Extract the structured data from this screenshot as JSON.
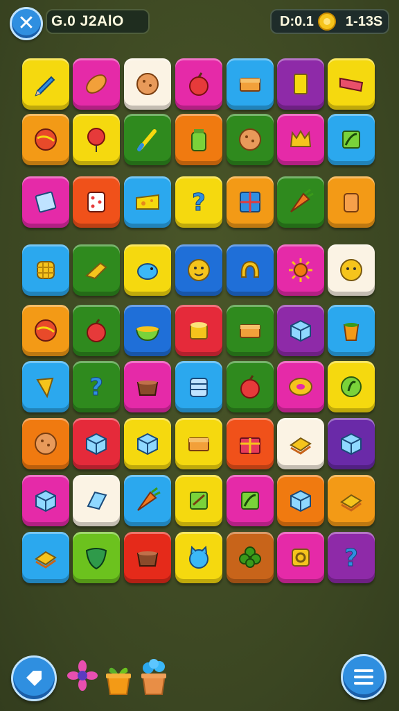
{
  "header": {
    "close_label": "✕",
    "title": "G.0 J2AlO",
    "timer": "D:0.1",
    "coins": "1-13S"
  },
  "grid": {
    "rows": 9,
    "cols": 7,
    "tiles": [
      {
        "color": "#f5d90f",
        "icon": "pencil-icon"
      },
      {
        "color": "#e52aa8",
        "icon": "bread-icon"
      },
      {
        "color": "#fbf3e4",
        "icon": "cookie-icon"
      },
      {
        "color": "#e52aa8",
        "icon": "apple-icon"
      },
      {
        "color": "#2ba8ee",
        "icon": "box-icon"
      },
      {
        "color": "#8e2aa8",
        "icon": "card-icon"
      },
      {
        "color": "#f5d90f",
        "icon": "book-icon"
      },
      {
        "color": "#f39a16",
        "icon": "ball-icon"
      },
      {
        "color": "#f5d90f",
        "icon": "balloon-icon"
      },
      {
        "color": "#2f8a1e",
        "icon": "brush-icon"
      },
      {
        "color": "#f07a10",
        "icon": "jar-icon"
      },
      {
        "color": "#2f8a1e",
        "icon": "cookie-icon"
      },
      {
        "color": "#e52aa8",
        "icon": "crown-icon"
      },
      {
        "color": "#2ba8ee",
        "icon": "leaf-card-icon"
      },
      {
        "color": "#e52aa8",
        "icon": "note-icon"
      },
      {
        "color": "#f0511a",
        "icon": "dice-icon"
      },
      {
        "color": "#2ba8ee",
        "icon": "cheese-icon"
      },
      {
        "color": "#f5d90f",
        "icon": "question-icon"
      },
      {
        "color": "#f39a16",
        "icon": "window-icon"
      },
      {
        "color": "#2f8a1e",
        "icon": "carrot-icon"
      },
      {
        "color": "#f39a16",
        "icon": "cylinder-icon"
      },
      {
        "color": "#2ba8ee",
        "icon": "waffle-icon"
      },
      {
        "color": "#2f8a1e",
        "icon": "whistle-icon"
      },
      {
        "color": "#f5d90f",
        "icon": "bird-icon"
      },
      {
        "color": "#1f6fd8",
        "icon": "smiley-icon"
      },
      {
        "color": "#1f6fd8",
        "icon": "horseshoe-icon"
      },
      {
        "color": "#e52aa8",
        "icon": "sun-icon"
      },
      {
        "color": "#fbf3e4",
        "icon": "face-icon"
      },
      {
        "color": "#f39a16",
        "icon": "ball-icon"
      },
      {
        "color": "#2f8a1e",
        "icon": "apple-icon"
      },
      {
        "color": "#1f6fd8",
        "icon": "bowl-icon"
      },
      {
        "color": "#e52a3a",
        "icon": "drum-icon"
      },
      {
        "color": "#2f8a1e",
        "icon": "box-icon"
      },
      {
        "color": "#8e2aa8",
        "icon": "cube-icon"
      },
      {
        "color": "#2ba8ee",
        "icon": "cup-icon"
      },
      {
        "color": "#2ba8ee",
        "icon": "cone-icon"
      },
      {
        "color": "#2f8a1e",
        "icon": "question-icon"
      },
      {
        "color": "#e52aa8",
        "icon": "pot-icon"
      },
      {
        "color": "#2ba8ee",
        "icon": "can-icon"
      },
      {
        "color": "#2f8a1e",
        "icon": "apple-icon"
      },
      {
        "color": "#e52aa8",
        "icon": "donut-icon"
      },
      {
        "color": "#f5d90f",
        "icon": "seed-icon"
      },
      {
        "color": "#f07a10",
        "icon": "cookie-icon"
      },
      {
        "color": "#e52a3a",
        "icon": "cube-icon"
      },
      {
        "color": "#f5d90f",
        "icon": "cube-icon"
      },
      {
        "color": "#f5d90f",
        "icon": "box-icon"
      },
      {
        "color": "#f0511a",
        "icon": "gift-icon"
      },
      {
        "color": "#fbf3e4",
        "icon": "sandwich-icon"
      },
      {
        "color": "#6a2aa8",
        "icon": "cube-icon"
      },
      {
        "color": "#e52aa8",
        "icon": "cube-icon"
      },
      {
        "color": "#fbf3e4",
        "icon": "gem-icon"
      },
      {
        "color": "#2ba8ee",
        "icon": "carrot-icon"
      },
      {
        "color": "#f5d90f",
        "icon": "fish-icon"
      },
      {
        "color": "#e52aa8",
        "icon": "leaf-card-icon"
      },
      {
        "color": "#f07a10",
        "icon": "cube-icon"
      },
      {
        "color": "#f39a16",
        "icon": "sandwich-icon"
      },
      {
        "color": "#2ba8ee",
        "icon": "sandwich-icon"
      },
      {
        "color": "#6cc21e",
        "icon": "shield-icon"
      },
      {
        "color": "#e52a1a",
        "icon": "pot-icon"
      },
      {
        "color": "#f5d90f",
        "icon": "cat-icon"
      },
      {
        "color": "#c8641a",
        "icon": "clover-icon"
      },
      {
        "color": "#e52aa8",
        "icon": "camera-icon"
      },
      {
        "color": "#8e2aa8",
        "icon": "question-icon"
      }
    ]
  },
  "footer": {
    "left_button_icon": "tag-icon",
    "menu_button_icon": "menu-icon",
    "decorations": [
      "flower-icon",
      "potted-plant-icon",
      "potted-plant-icon"
    ]
  }
}
